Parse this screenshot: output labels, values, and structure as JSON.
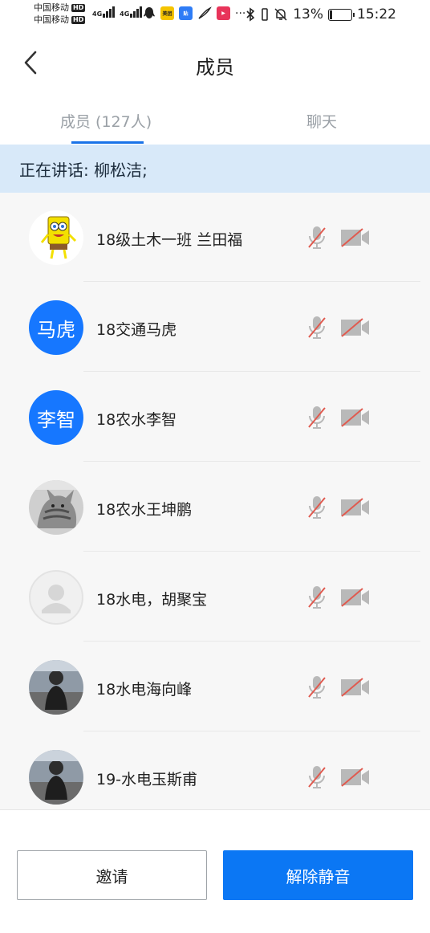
{
  "status_bar": {
    "carrier1": "中国移动",
    "carrier2": "中国移动",
    "hd": "HD",
    "network1": "4G",
    "network2": "4G",
    "more": "···",
    "battery": "13%",
    "battery_level": 0.13,
    "time": "15:22"
  },
  "header": {
    "title": "成员"
  },
  "tabs": {
    "members": "成员 (127人)",
    "chat": "聊天"
  },
  "speaking": {
    "text": "正在讲话: 柳松洁;"
  },
  "members": [
    {
      "name": "18级土木一班 兰田福",
      "avatar": "spongebob-avatar",
      "avatar_text": ""
    },
    {
      "name": "18交通马虎",
      "avatar": "text",
      "avatar_text": "马虎"
    },
    {
      "name": "18农水李智",
      "avatar": "text",
      "avatar_text": "李智"
    },
    {
      "name": "18农水王坤鹏",
      "avatar": "cat-photo-avatar",
      "avatar_text": ""
    },
    {
      "name": "18水电，胡聚宝",
      "avatar": "default-avatar",
      "avatar_text": ""
    },
    {
      "name": "18水电海向峰",
      "avatar": "person-photo-avatar",
      "avatar_text": ""
    },
    {
      "name": "19-水电玉斯甫",
      "avatar": "person-photo-avatar",
      "avatar_text": ""
    }
  ],
  "icons": {
    "mic": "mic-muted-icon",
    "camera": "camera-off-icon"
  },
  "colors": {
    "accent": "#1677ff",
    "button": "#0b77f4",
    "muted_red": "#e05a4f",
    "speaking_bg": "#d8e9f9"
  },
  "footer": {
    "invite": "邀请",
    "unmute": "解除静音"
  }
}
